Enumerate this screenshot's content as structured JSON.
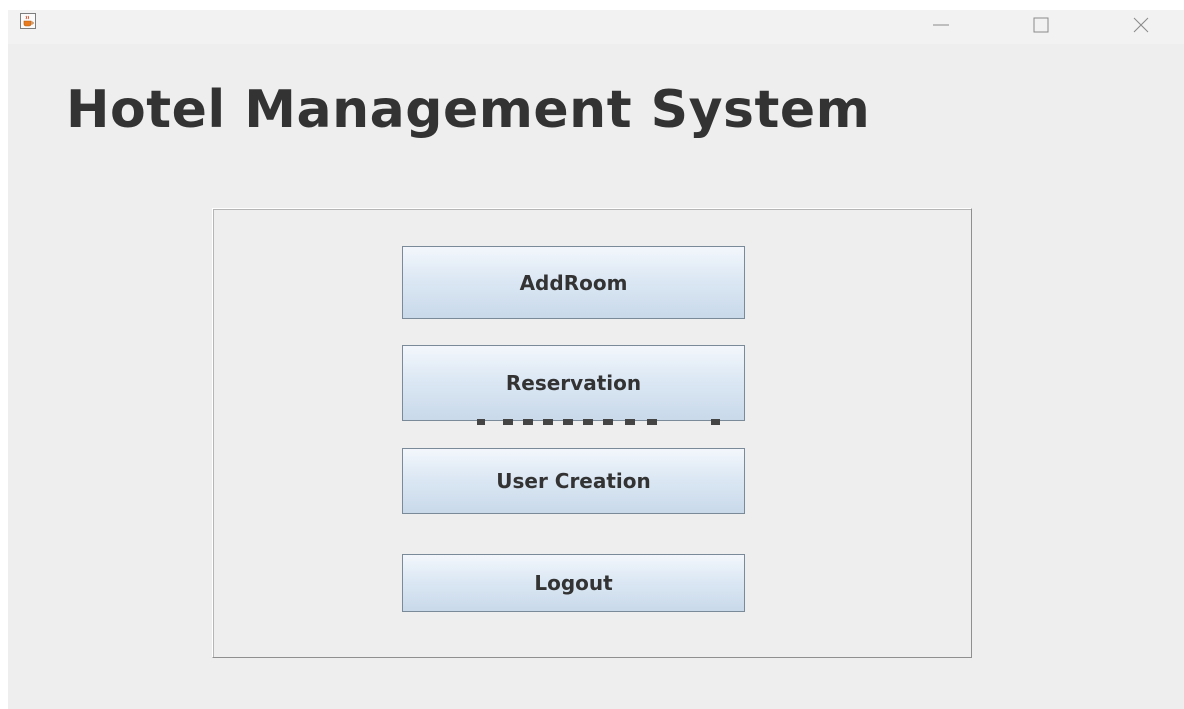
{
  "window": {
    "icon": "java-coffee-cup-icon",
    "controls": [
      "minimize-icon",
      "maximize-icon",
      "close-icon"
    ]
  },
  "heading": "Hotel Management System",
  "buttons": {
    "add_room": "AddRoom",
    "reservation": "Reservation",
    "user_creation": "User Creation",
    "logout": "Logout"
  },
  "colors": {
    "window_bg": "#eeeeee",
    "heading": "#333333",
    "button_gradient_top": "#f3f7fc",
    "button_gradient_bottom": "#c9d9ea",
    "button_border": "#7a8a99"
  }
}
